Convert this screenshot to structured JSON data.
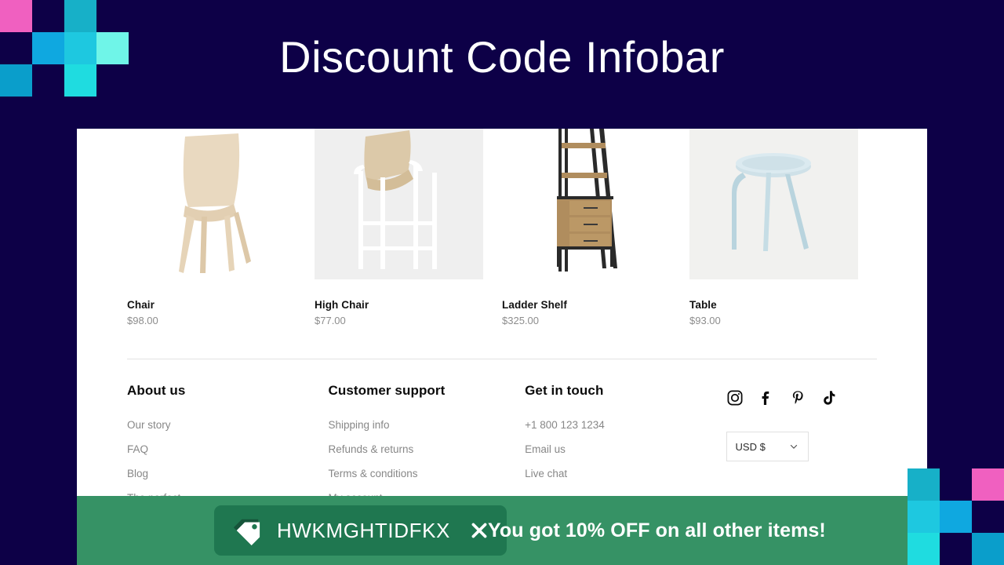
{
  "page": {
    "title": "Discount Code Infobar",
    "background_color": "#0d0047"
  },
  "decor": {
    "top_left": {
      "cols": 4,
      "rows": 3,
      "cells": [
        "#f060c0",
        "#0d0047",
        "#17b0c8",
        "#0d0047",
        "#0d0047",
        "#0fa8e0",
        "#1ec8e0",
        "#6ff5e8",
        "#0a9ecb",
        "#0d0047",
        "#1fdce0",
        "#0d0047"
      ]
    },
    "bottom_right": {
      "cols": 3,
      "rows": 3,
      "cells": [
        "#17b0c8",
        "#0d0047",
        "#f060c0",
        "#1ec8e0",
        "#0fa8e0",
        "#0d0047",
        "#1fdce0",
        "#0d0047",
        "#0a9ecb"
      ]
    }
  },
  "store": {
    "products": [
      {
        "name": "Chair",
        "price": "$98.00",
        "image": "beige-chair-photo",
        "bg": "#ffffff"
      },
      {
        "name": "High Chair",
        "price": "$77.00",
        "image": "wooden-high-chair-photo",
        "bg": "#f0f0f0"
      },
      {
        "name": "Ladder Shelf",
        "price": "$325.00",
        "image": "ladder-shelf-photo",
        "bg": "#ffffff"
      },
      {
        "name": "Table",
        "price": "$93.00",
        "image": "blue-side-table-photo",
        "bg": "#f2f2f0"
      }
    ],
    "footer": {
      "columns": [
        {
          "heading": "About us",
          "links": [
            "Our story",
            "FAQ",
            "Blog",
            "The perfect"
          ]
        },
        {
          "heading": "Customer support",
          "links": [
            "Shipping info",
            "Refunds & returns",
            "Terms & conditions",
            "My account"
          ]
        },
        {
          "heading": "Get in touch",
          "links": [
            "+1 800 123 1234",
            "Email us",
            "Live chat"
          ]
        }
      ],
      "social": [
        {
          "name": "instagram-icon"
        },
        {
          "name": "facebook-icon"
        },
        {
          "name": "pinterest-icon"
        },
        {
          "name": "tiktok-icon"
        }
      ],
      "currency": {
        "value": "USD $",
        "chevron": "chevron-down-icon"
      }
    }
  },
  "infobar": {
    "background_color": "#369265",
    "pill_color": "#1f7750",
    "tag_icon": "tag-icon",
    "coupon_code": "HWKMGHTIDFKX",
    "close_icon": "close-icon",
    "message": "You got 10% OFF on all other items!"
  }
}
